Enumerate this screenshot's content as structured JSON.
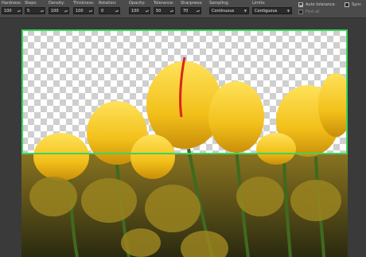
{
  "toolbar": {
    "hardness": {
      "label": "Hardness:",
      "value": "100"
    },
    "steps": {
      "label": "Steps:",
      "value": "5"
    },
    "density": {
      "label": "Density:",
      "value": "100"
    },
    "thickness": {
      "label": "Thickness:",
      "value": "100"
    },
    "rotation": {
      "label": "Rotation:",
      "value": "0"
    },
    "opacity": {
      "label": "Opacity:",
      "value": "100"
    },
    "tolerance": {
      "label": "Tolerance:",
      "value": "50"
    },
    "sharpness": {
      "label": "Sharpness:",
      "value": "70"
    },
    "sampling": {
      "label": "Sampling:",
      "value": "Continuous"
    },
    "limits": {
      "label": "Limits:",
      "value": "Contiguous"
    },
    "auto_tolerance": {
      "label": "Auto tolerance",
      "checked": true
    },
    "find_all": {
      "label": "Find all",
      "checked": false
    },
    "sync": {
      "label": "Sync",
      "checked": false
    }
  },
  "colors": {
    "selection": "#3bd45a",
    "toolbar_bg": "#4b4b4b",
    "workspace_bg": "#3a3a3a",
    "tulip": "#f5c518"
  }
}
